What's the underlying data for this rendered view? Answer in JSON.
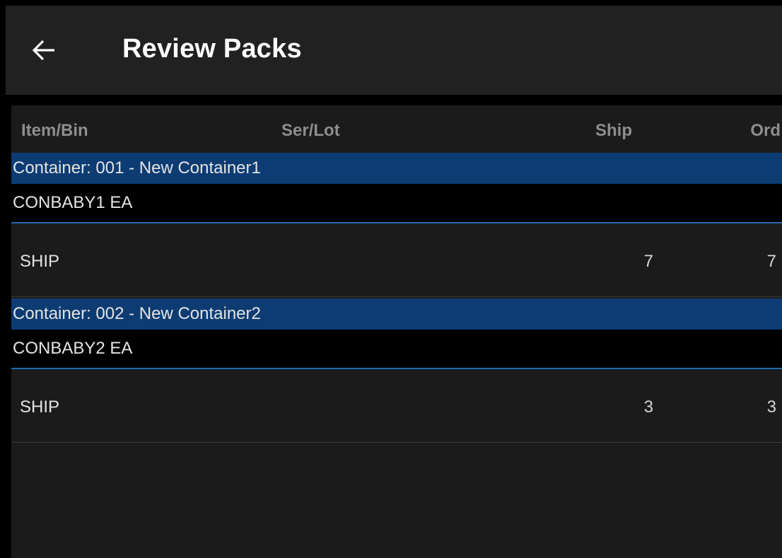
{
  "header": {
    "title": "Review Packs",
    "back_icon": "arrow-left-icon"
  },
  "columns": {
    "item_bin": "Item/Bin",
    "ser_lot": "Ser/Lot",
    "ship": "Ship",
    "ord": "Ord"
  },
  "containers": [
    {
      "label": "Container: 001 - New Container1",
      "item": "CONBABY1  EA",
      "bin": "SHIP",
      "ship": "7",
      "ord": "7"
    },
    {
      "label": "Container: 002 - New Container2",
      "item": "CONBABY2  EA",
      "bin": "SHIP",
      "ship": "3",
      "ord": "3"
    }
  ],
  "colors": {
    "app_bar": "#212121",
    "container_bar": "#0d3c73",
    "divider_accent": "#1f6cb0",
    "list_bg": "#1b1b1b"
  }
}
